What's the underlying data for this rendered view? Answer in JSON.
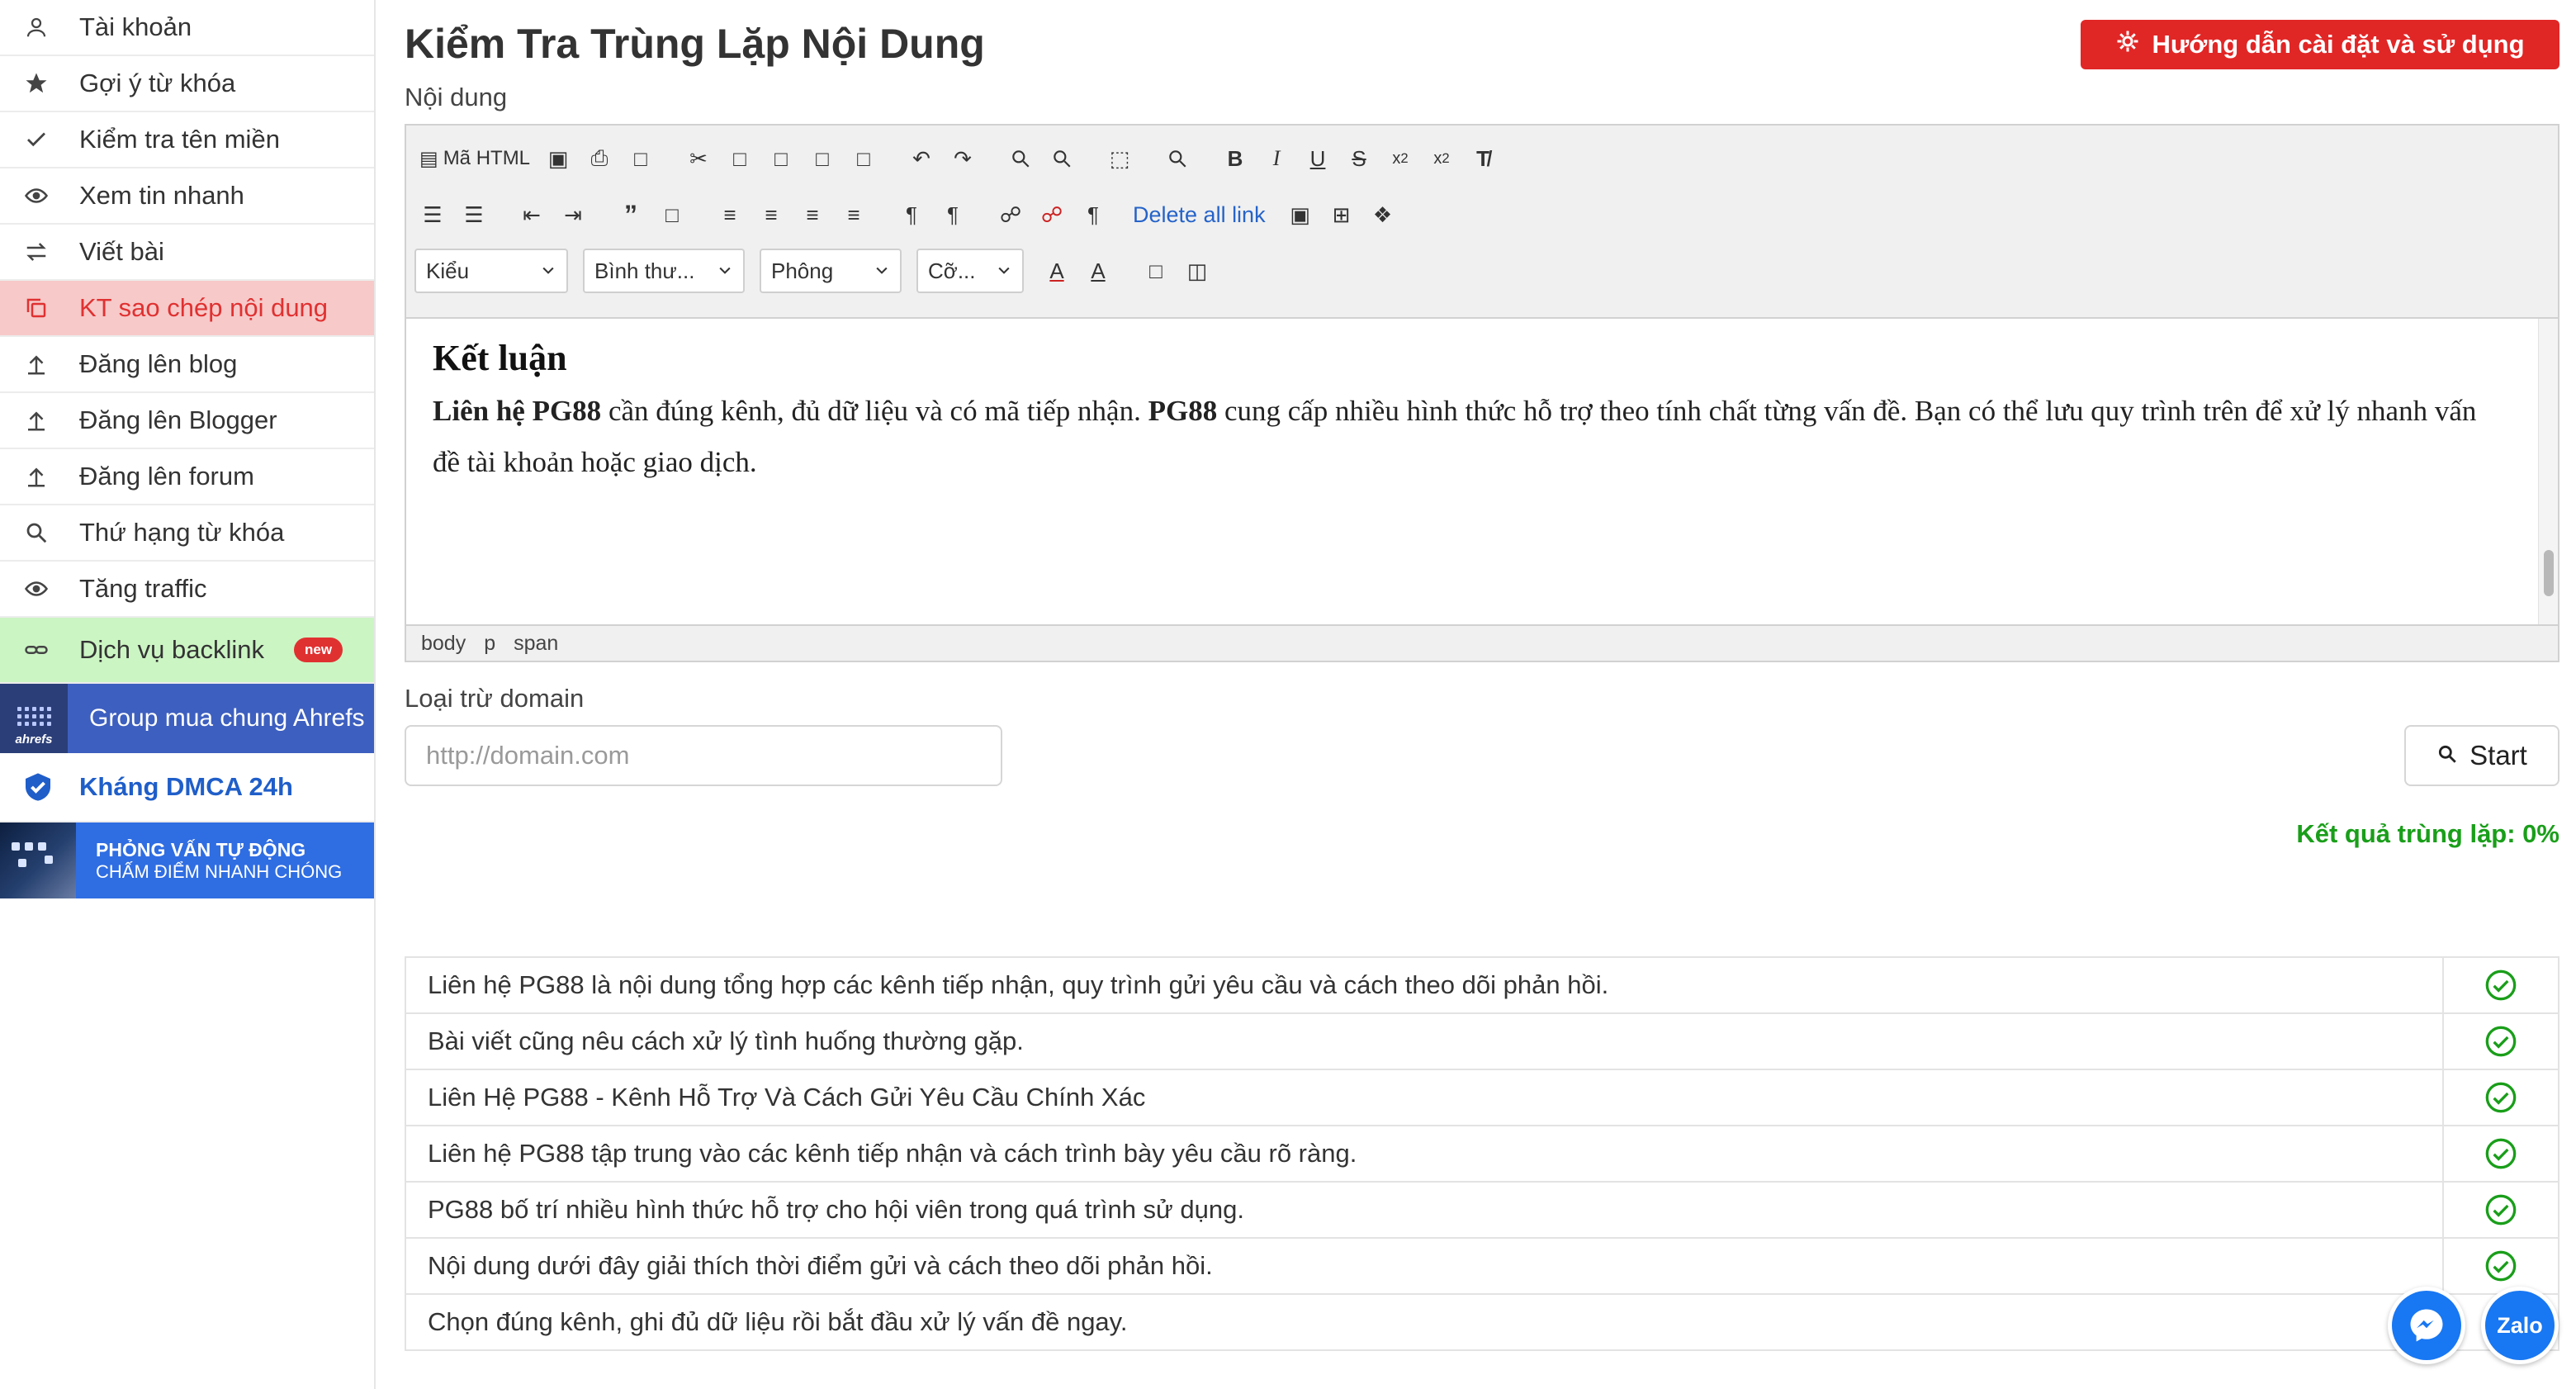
{
  "sidebar": {
    "items": [
      {
        "label": "Tài khoản",
        "icon": "user-icon"
      },
      {
        "label": "Gợi ý từ khóa",
        "icon": "star-icon"
      },
      {
        "label": "Kiểm tra tên miền",
        "icon": "check-icon"
      },
      {
        "label": "Xem tin nhanh",
        "icon": "eye-icon"
      },
      {
        "label": "Viết bài",
        "icon": "swap-icon"
      },
      {
        "label": "KT sao chép nội dung",
        "icon": "copy-icon",
        "active": true
      },
      {
        "label": "Đăng lên blog",
        "icon": "upload-icon"
      },
      {
        "label": "Đăng lên Blogger",
        "icon": "upload-icon"
      },
      {
        "label": "Đăng lên forum",
        "icon": "upload-icon"
      },
      {
        "label": "Thứ hạng từ khóa",
        "icon": "search-icon"
      },
      {
        "label": "Tăng traffic",
        "icon": "eye-icon"
      }
    ],
    "backlink": {
      "label": "Dịch vụ backlink",
      "badge": "new",
      "icon": "link-icon"
    },
    "ahrefs": {
      "label": "Group mua chung Ahrefs",
      "logo_text": "ahrefs"
    },
    "dmca": {
      "label": "Kháng DMCA 24h",
      "icon": "shield-check-icon"
    },
    "banner": {
      "line1": "PHỎNG VẤN TỰ ĐỘNG",
      "line2": "CHẤM ĐIỂM NHANH CHÓNG"
    }
  },
  "header": {
    "title": "Kiểm Tra Trùng Lặp Nội Dung",
    "guide_button": "Hướng dẫn cài đặt và sử dụng"
  },
  "editor": {
    "label": "Nội dung",
    "toolbar": {
      "source_label": "Mã HTML",
      "delete_links": "Delete all link",
      "style_select": "Kiểu",
      "format_select": "Bình thư...",
      "font_select": "Phông",
      "size_select": "Cỡ..."
    },
    "content": {
      "heading": "Kết luận",
      "p_bold1": "Liên hệ PG88",
      "p_text1": " cần đúng kênh, đủ dữ liệu và có mã tiếp nhận. ",
      "p_bold2": "PG88",
      "p_text2": " cung cấp nhiều hình thức hỗ trợ theo tính chất từng vấn đề. Bạn có thể lưu quy trình trên để xử lý nhanh vấn đề tài khoản hoặc giao dịch."
    },
    "path": [
      "body",
      "p",
      "span"
    ]
  },
  "exclude": {
    "label": "Loại trừ domain",
    "placeholder": "http://domain.com",
    "start_button": "Start"
  },
  "result_text": "Kết quả trùng lặp: 0%",
  "results": [
    {
      "text": "Liên hệ PG88 là nội dung tổng hợp các kênh tiếp nhận, quy trình gửi yêu cầu và cách theo dõi phản hồi.",
      "unique": true
    },
    {
      "text": "Bài viết cũng nêu cách xử lý tình huống thường gặp.",
      "unique": true
    },
    {
      "text": "Liên Hệ PG88 - Kênh Hỗ Trợ Và Cách Gửi Yêu Cầu Chính Xác",
      "unique": true
    },
    {
      "text": "Liên hệ PG88 tập trung vào các kênh tiếp nhận và cách trình bày yêu cầu rõ ràng.",
      "unique": true
    },
    {
      "text": "PG88 bố trí nhiều hình thức hỗ trợ cho hội viên trong quá trình sử dụng.",
      "unique": true
    },
    {
      "text": "Nội dung dưới đây giải thích thời điểm gửi và cách theo dõi phản hồi.",
      "unique": true
    },
    {
      "text": "Chọn đúng kênh, ghi đủ dữ liệu rồi bắt đầu xử lý vấn đề ngay.",
      "unique": false
    }
  ],
  "floating": {
    "zalo_label": "Zalo"
  },
  "colors": {
    "accent_red": "#e12626",
    "active_bg": "#f7c9c9",
    "success": "#1a9e1a",
    "link_blue": "#2563c9"
  }
}
